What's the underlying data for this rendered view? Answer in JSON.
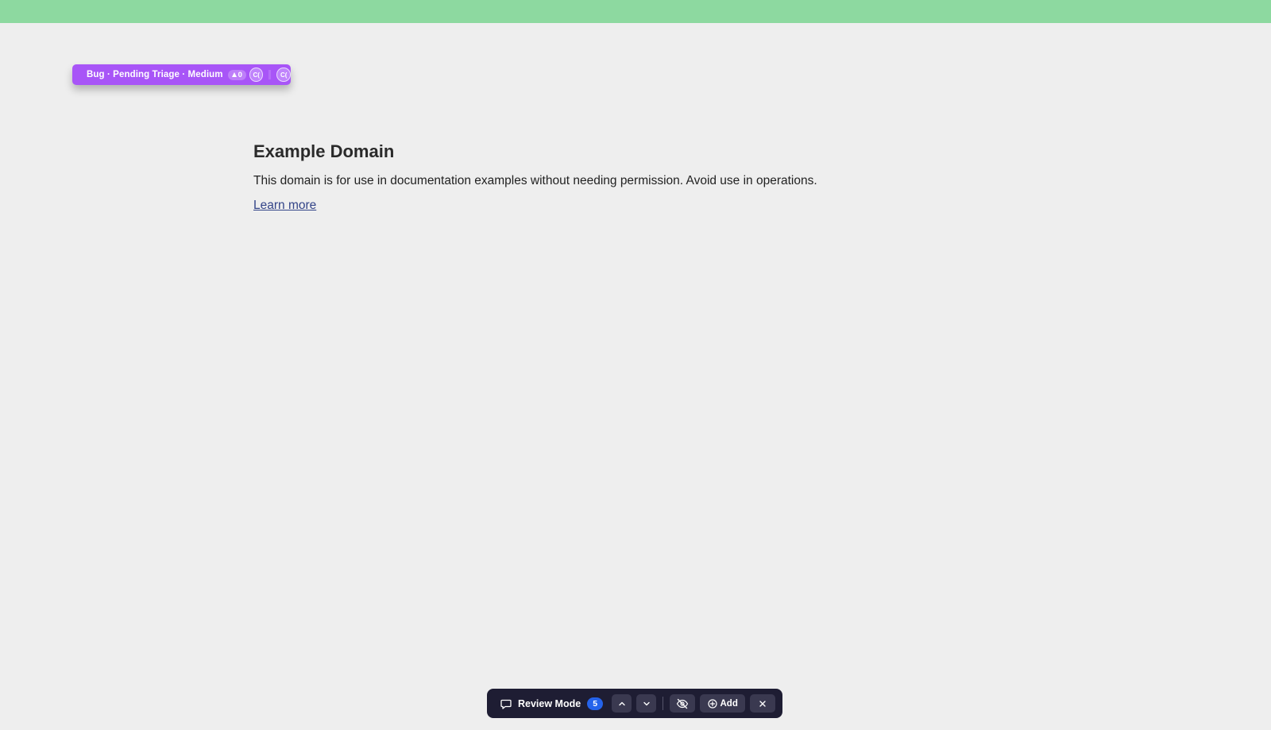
{
  "annotation": {
    "label": "Bug · Pending Triage · Medium",
    "votes": "0",
    "avatars": [
      "C(",
      "C("
    ],
    "color": "#a855f7"
  },
  "page": {
    "title": "Example Domain",
    "body": "This domain is for use in documentation examples without needing permission. Avoid use in operations.",
    "link": "Learn more"
  },
  "review_bar": {
    "mode_label": "Review Mode",
    "count": "5",
    "add_label": "Add",
    "icons": [
      "chat-bubble-icon",
      "chevron-up-icon",
      "chevron-down-icon",
      "eye-off-icon",
      "plus-circle-icon",
      "close-icon"
    ],
    "badge_color": "#2563eb"
  },
  "colors": {
    "top_bar": "#8dd9a0",
    "background": "#eeeeee",
    "toolbar": "#1e1d33"
  }
}
